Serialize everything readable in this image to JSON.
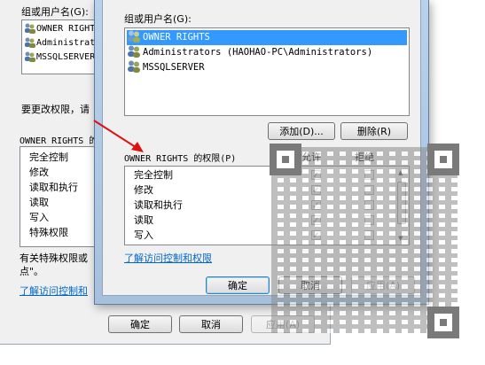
{
  "background_dialog": {
    "group_label": "组或用户名(G):",
    "users": [
      "OWNER RIGHTS",
      "Administrators",
      "MSSQLSERVER"
    ],
    "change_perm_text": "要更改权限，请",
    "perm_label": "OWNER RIGHTS 的",
    "permissions": [
      "完全控制",
      "修改",
      "读取和执行",
      "读取",
      "写入",
      "特殊权限"
    ],
    "special_text_1": "有关特殊权限或",
    "special_text_2": "点\"。",
    "link_text": "了解访问控制和",
    "buttons": {
      "ok": "确定",
      "cancel": "取消",
      "apply": "应用(A)"
    }
  },
  "dialog": {
    "group_label": "组或用户名(G):",
    "users": [
      {
        "name": "OWNER RIGHTS",
        "selected": true
      },
      {
        "name": "Administrators (HAOHAO-PC\\Administrators)",
        "selected": false
      },
      {
        "name": "MSSQLSERVER",
        "selected": false
      }
    ],
    "add_button": "添加(D)...",
    "remove_button": "删除(R)",
    "perm_header": "OWNER RIGHTS 的权限(P)",
    "allow_header": "允许",
    "deny_header": "拒绝",
    "permissions": [
      {
        "name": "完全控制",
        "allow": true,
        "deny": false
      },
      {
        "name": "修改",
        "allow": true,
        "deny": false
      },
      {
        "name": "读取和执行",
        "allow": true,
        "deny": false
      },
      {
        "name": "读取",
        "allow": true,
        "deny": false
      },
      {
        "name": "写入",
        "allow": true,
        "deny": false
      }
    ],
    "link_text": "了解访问控制和权限",
    "ok_button": "确定",
    "cancel_button": "取消",
    "apply_button": "应用(A)"
  },
  "colors": {
    "selection": "#3399ff",
    "link": "#0066cc",
    "arrow": "#e01010"
  }
}
